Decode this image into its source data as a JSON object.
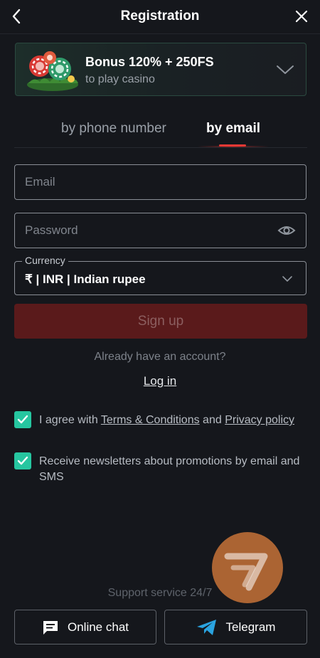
{
  "header": {
    "title": "Registration"
  },
  "bonus": {
    "title": "Bonus 120% + 250FS",
    "subtitle": "to play casino"
  },
  "tabs": [
    {
      "label": "by phone number",
      "active": false
    },
    {
      "label": "by email",
      "active": true
    }
  ],
  "form": {
    "email_placeholder": "Email",
    "password_placeholder": "Password",
    "currency_label": "Currency",
    "currency_value": "₹ | INR | Indian rupee",
    "signup_label": "Sign up"
  },
  "account": {
    "question": "Already have an account?",
    "login_label": "Log in"
  },
  "consents": {
    "agree_prefix": "I agree with ",
    "terms_link": "Terms & Conditions",
    "and_text": " and ",
    "privacy_link": "Privacy policy",
    "agree_checked": true,
    "newsletter_text": "Receive newsletters about promotions by email and SMS",
    "newsletter_checked": true
  },
  "support": {
    "label": "Support service 24/7",
    "chat_label": "Online chat",
    "telegram_label": "Telegram"
  },
  "colors": {
    "accent": "#e53935",
    "check": "#26c6a0",
    "signup_bg": "#5a1a1b",
    "telegram": "#2aa3e0",
    "fab": "#d67a3a"
  },
  "icons": {
    "back": "chevron-left-icon",
    "close": "close-icon",
    "expand": "chevron-down-icon",
    "password_toggle": "eye-icon",
    "chat": "chat-bubble-icon",
    "telegram": "telegram-icon"
  }
}
